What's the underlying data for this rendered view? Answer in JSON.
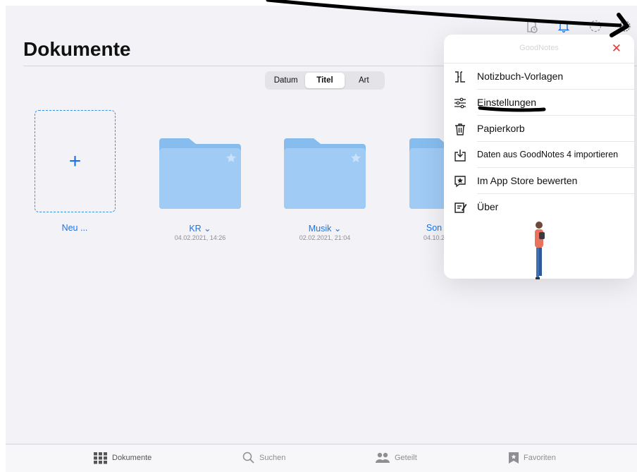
{
  "header": {
    "title": "Dokumente",
    "icons": [
      "document-clock-icon",
      "bell-icon",
      "sync-icon",
      "gear-icon"
    ]
  },
  "sort": {
    "options": [
      "Datum",
      "Titel",
      "Art"
    ],
    "selected": "Titel"
  },
  "grid": {
    "new_label": "Neu ...",
    "items": [
      {
        "label": "KR ⌄",
        "date": "04.02.2021, 14:26"
      },
      {
        "label": "Musik ⌄",
        "date": "02.02.2021, 21:04"
      },
      {
        "label": "Son",
        "date": "04.10.2"
      }
    ]
  },
  "menu": {
    "app_name": "GoodNotes",
    "items": [
      {
        "label": "Notizbuch-Vorlagen",
        "icon": "notebook-templates-icon"
      },
      {
        "label": "Einstellungen",
        "icon": "sliders-icon"
      },
      {
        "label": "Papierkorb",
        "icon": "trash-icon"
      },
      {
        "label": "Daten aus GoodNotes 4 importieren",
        "icon": "import-icon"
      },
      {
        "label": "Im App Store bewerten",
        "icon": "rate-star-icon"
      },
      {
        "label": "Über",
        "icon": "about-icon"
      }
    ]
  },
  "tabbar": {
    "tabs": [
      {
        "label": "Dokumente",
        "icon": "grid-icon",
        "active": true
      },
      {
        "label": "Suchen",
        "icon": "search-icon",
        "active": false
      },
      {
        "label": "Geteilt",
        "icon": "people-icon",
        "active": false
      },
      {
        "label": "Favoriten",
        "icon": "bookmark-star-icon",
        "active": false
      }
    ]
  },
  "colors": {
    "accent": "#1a73e8",
    "folder": "#9fcbf5",
    "folder_tab": "#86bdee",
    "close": "#e53935",
    "annotation": "#000000"
  }
}
